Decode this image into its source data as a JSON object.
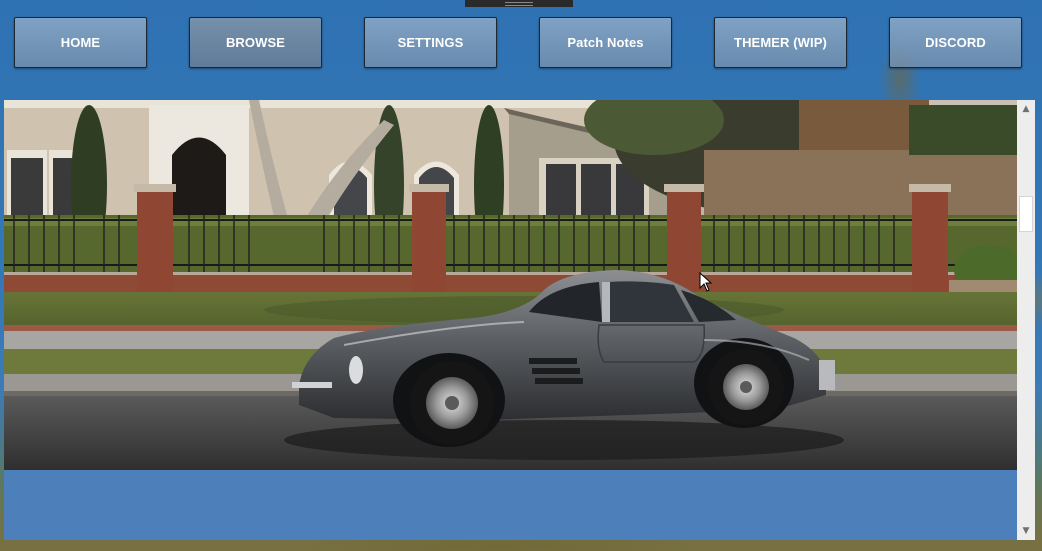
{
  "nav": {
    "items": [
      {
        "label": "HOME"
      },
      {
        "label": "BROWSE"
      },
      {
        "label": "SETTINGS"
      },
      {
        "label": "Patch Notes"
      },
      {
        "label": "THEMER (WIP)"
      },
      {
        "label": "DISCORD"
      }
    ],
    "active_index": 1
  },
  "hero": {
    "image_icon": "classic-silver-gullwing-car-in-front-of-house"
  },
  "colors": {
    "panel": "#4d7fbb",
    "button_bg": "#8aa4be",
    "button_text": "#ffffff",
    "scrollbar_track": "#ededed"
  },
  "icons": {
    "scroll_up": "chevron-up-icon",
    "scroll_down": "chevron-down-icon",
    "cursor": "mouse-pointer-icon"
  }
}
